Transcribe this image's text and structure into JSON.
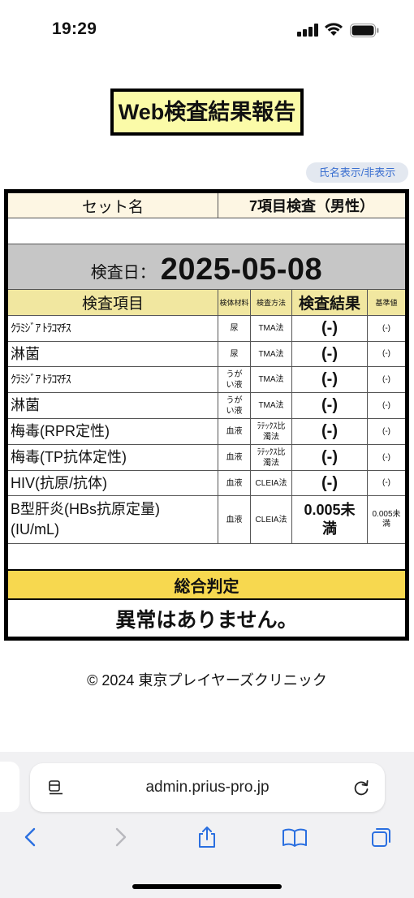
{
  "status_bar": {
    "time": "19:29"
  },
  "page": {
    "title": "Web検査結果報告",
    "name_toggle": "氏名表示/非表示"
  },
  "report": {
    "set_label": "セット名",
    "set_value": "7項目検査（男性）",
    "date_label": "検査日：",
    "date_value": "2025-05-08",
    "columns": {
      "item": "検査項目",
      "specimen": "検体材料",
      "method": "検査方法",
      "result": "検査結果",
      "reference": "基準値"
    },
    "rows": [
      {
        "item": "ｸﾗﾐｼﾞｱ ﾄﾗｺﾏﾁｽ",
        "specimen": "尿",
        "method": "TMA法",
        "result": "(-)",
        "reference": "(-)"
      },
      {
        "item": "淋菌",
        "specimen": "尿",
        "method": "TMA法",
        "result": "(-)",
        "reference": "(-)"
      },
      {
        "item": "ｸﾗﾐｼﾞｱ ﾄﾗｺﾏﾁｽ",
        "specimen": "うがい液",
        "method": "TMA法",
        "result": "(-)",
        "reference": "(-)"
      },
      {
        "item": "淋菌",
        "specimen": "うがい液",
        "method": "TMA法",
        "result": "(-)",
        "reference": "(-)"
      },
      {
        "item": "梅毒(RPR定性)",
        "specimen": "血液",
        "method": "ﾗﾃｯｸｽ比濁法",
        "result": "(-)",
        "reference": "(-)"
      },
      {
        "item": "梅毒(TP抗体定性)",
        "specimen": "血液",
        "method": "ﾗﾃｯｸｽ比濁法",
        "result": "(-)",
        "reference": "(-)"
      },
      {
        "item": "HIV(抗原/抗体)",
        "specimen": "血液",
        "method": "CLEIA法",
        "result": "(-)",
        "reference": "(-)"
      },
      {
        "item": "B型肝炎(HBs抗原定量)(IU/mL)",
        "specimen": "血液",
        "method": "CLEIA法",
        "result": "0.005未満",
        "reference": "0.005未満"
      }
    ],
    "judgement_label": "総合判定",
    "judgement_value": "異常はありません。"
  },
  "footer": {
    "copyright": "© 2024 東京プレイヤーズクリニック"
  },
  "browser": {
    "url": "admin.prius-pro.jp"
  }
}
